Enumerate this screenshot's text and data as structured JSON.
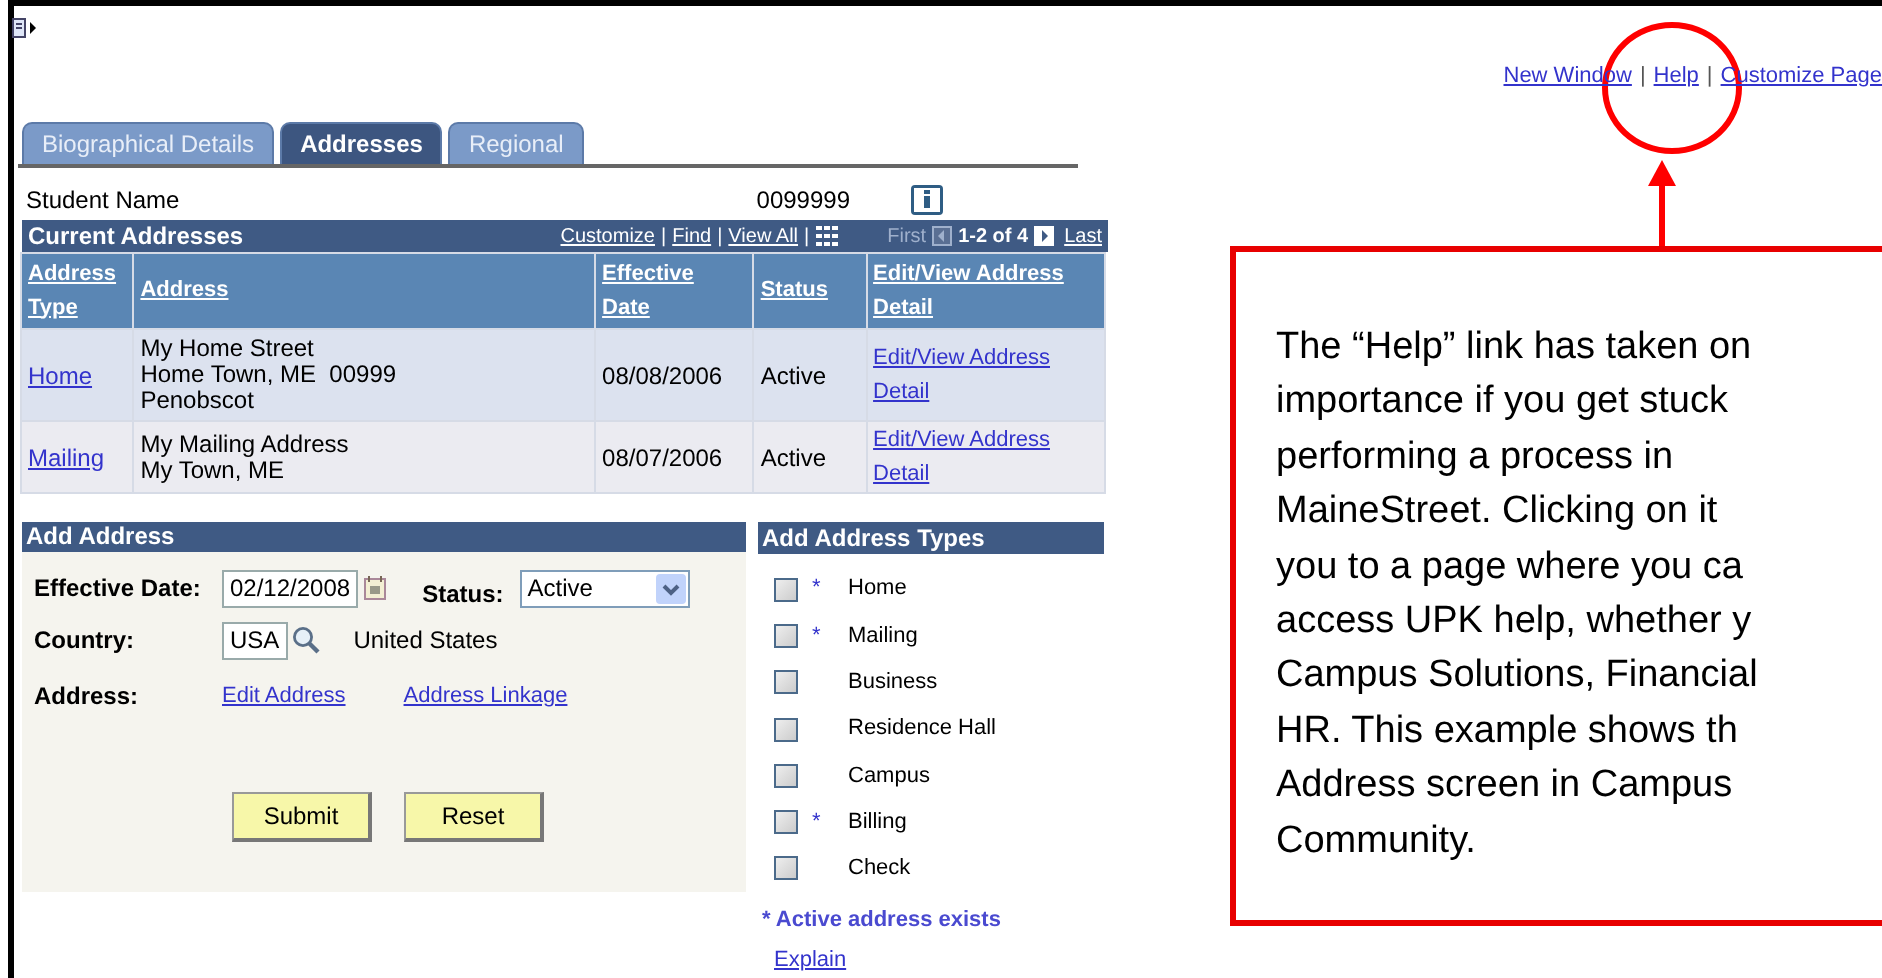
{
  "header_links": [
    "New Window",
    "Help",
    "Customize Page"
  ],
  "link_separator": "|",
  "tabs": [
    {
      "label": "Biographical Details",
      "selected": false
    },
    {
      "label": "Addresses",
      "selected": true
    },
    {
      "label": "Regional",
      "selected": false
    }
  ],
  "student": {
    "name_label": "Student Name",
    "id": "0099999"
  },
  "current_addresses": {
    "title": "Current Addresses",
    "nav_links": [
      "Customize",
      "Find",
      "View All"
    ],
    "pager": {
      "first": "First",
      "range": "1-2 of 4",
      "last": "Last"
    },
    "columns": [
      "Address Type",
      "Address",
      "Effective Date",
      "Status",
      "Edit/View Address Detail"
    ],
    "rows": [
      {
        "type": "Home",
        "address_lines": [
          "My Home Street",
          "Home Town, ME  00999",
          "Penobscot"
        ],
        "effective_date": "08/08/2006",
        "status": "Active",
        "detail_link": "Edit/View Address Detail"
      },
      {
        "type": "Mailing",
        "address_lines": [
          "My Mailing Address",
          "My Town, ME"
        ],
        "effective_date": "08/07/2006",
        "status": "Active",
        "detail_link": "Edit/View Address Detail"
      }
    ]
  },
  "add_address": {
    "title": "Add Address",
    "effective_date_label": "Effective Date:",
    "effective_date": "02/12/2008",
    "status_label": "Status:",
    "status": "Active",
    "country_label": "Country:",
    "country_code": "USA",
    "country_name": "United States",
    "address_label": "Address:",
    "links": [
      "Edit Address",
      "Address Linkage"
    ],
    "buttons": [
      "Submit",
      "Reset"
    ]
  },
  "address_types": {
    "title": "Add Address Types",
    "items": [
      {
        "label": "Home",
        "marker": "*",
        "checked": false
      },
      {
        "label": "Mailing",
        "marker": "*",
        "checked": false
      },
      {
        "label": "Business",
        "checked": false
      },
      {
        "label": "Residence Hall",
        "checked": false
      },
      {
        "label": "Campus",
        "checked": false
      },
      {
        "label": "Billing",
        "marker": "*",
        "checked": false
      },
      {
        "label": "Check",
        "checked": false
      }
    ],
    "legend": "* Active address exists",
    "explain_link": "Explain"
  },
  "callout": {
    "lines": [
      "The “Help” link has taken on",
      "importance if you get stuck",
      "performing a process in",
      "MaineStreet.  Clicking on it",
      "you to a page where you ca",
      "access UPK help, whether y",
      "Campus Solutions, Financial",
      "HR.  This example shows th",
      "Address screen in Campus",
      "Community."
    ]
  }
}
